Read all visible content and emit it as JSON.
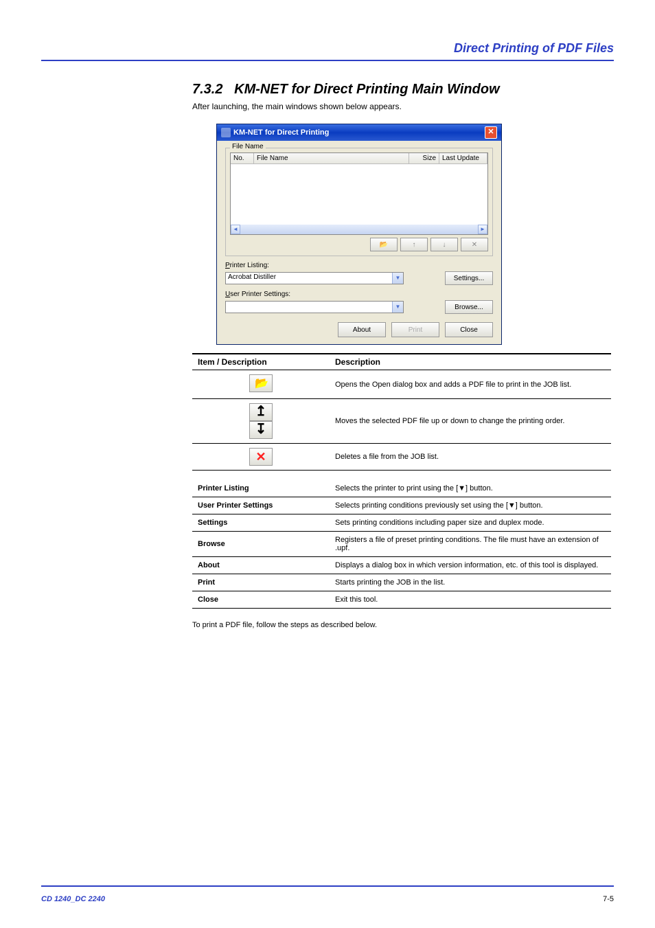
{
  "header": {
    "running_title": "Direct Printing of PDF Files"
  },
  "section": {
    "number": "7.3.2",
    "title": "KM-NET for Direct Printing Main Window",
    "subtitle": "After launching, the main windows shown below appears."
  },
  "dialog": {
    "title": "KM-NET for Direct Printing",
    "group_label": "File Name",
    "columns": {
      "no": "No.",
      "file_name": "File Name",
      "size": "Size",
      "last_update": "Last Update"
    },
    "printer_listing_label": "Printer Listing:",
    "printer_listing_value": "Acrobat Distiller",
    "user_settings_label": "User Printer Settings:",
    "user_settings_value": "",
    "buttons": {
      "settings": "Settings...",
      "browse": "Browse...",
      "about": "About",
      "print": "Print",
      "close": "Close"
    }
  },
  "tables": {
    "t1_headers": {
      "item": "Item / Description",
      "desc": "Description"
    },
    "t1_rows": [
      {
        "icon": "folder",
        "desc": "Opens the Open dialog box and adds a PDF file to print in the JOB list."
      },
      {
        "icon": "arrows",
        "desc": "Moves the selected PDF file up or down to change the printing order."
      },
      {
        "icon": "x",
        "desc": "Deletes a file from the JOB list."
      }
    ],
    "t2_rows": [
      {
        "key": "Printer Listing",
        "desc": "Selects the printer to print using the [▼] button."
      },
      {
        "key": "User Printer Settings",
        "desc": "Selects printing conditions previously set using the [▼] button."
      },
      {
        "key": "Settings",
        "desc": "Sets printing conditions including paper size and duplex mode."
      },
      {
        "key": "Browse",
        "desc": "Registers a file of preset printing conditions. The file must have an extension of .upf."
      },
      {
        "key": "About",
        "desc": "Displays a dialog box in which version information, etc. of this tool is displayed."
      },
      {
        "key": "Print",
        "desc": "Starts printing the JOB in the list."
      },
      {
        "key": "Close",
        "desc": "Exit this tool."
      }
    ]
  },
  "note": "To print a PDF file, follow the steps as described below.",
  "footer": {
    "product": "CD 1240_DC 2240",
    "page": "7-5"
  }
}
